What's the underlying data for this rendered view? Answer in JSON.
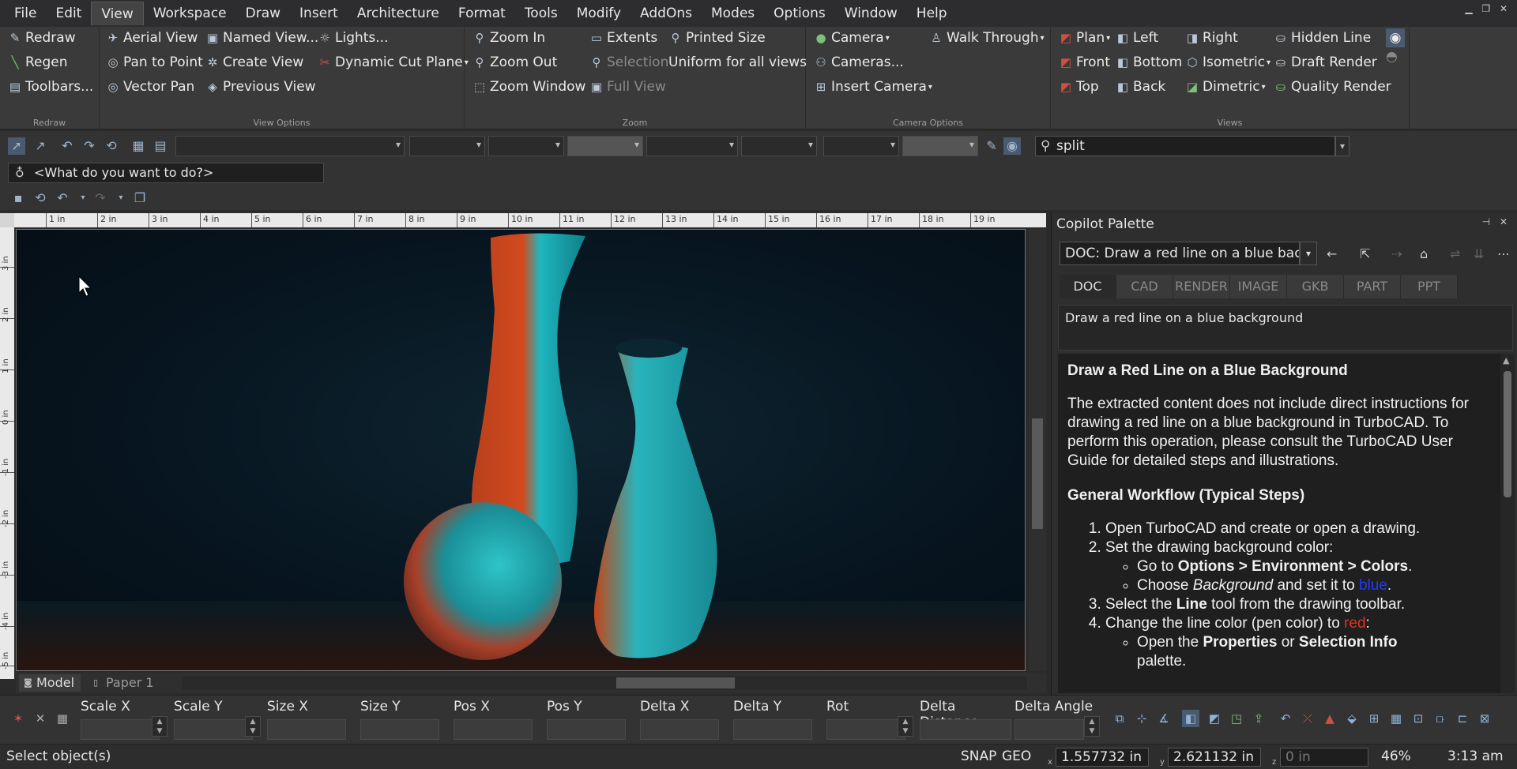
{
  "menu": [
    "File",
    "Edit",
    "View",
    "Workspace",
    "Draw",
    "Insert",
    "Architecture",
    "Format",
    "Tools",
    "Modify",
    "AddOns",
    "Modes",
    "Options",
    "Window",
    "Help"
  ],
  "active_menu": "View",
  "ribbon": {
    "redraw": {
      "title": "Redraw",
      "items": [
        "Redraw",
        "Regen",
        "Toolbars..."
      ]
    },
    "view_options": {
      "title": "View Options",
      "col1": [
        "Aerial View",
        "Pan to Point",
        "Vector Pan"
      ],
      "col2": [
        "Named View...",
        "Create View",
        "Previous View"
      ],
      "col3": [
        "Lights...",
        "Dynamic Cut Plane"
      ]
    },
    "zoom": {
      "title": "Zoom",
      "col1": [
        "Zoom In",
        "Zoom Out",
        "Zoom Window"
      ],
      "col2": [
        "Extents",
        "Selection",
        "Full View"
      ],
      "col3": [
        "Printed Size",
        "Uniform for all views"
      ]
    },
    "camera": {
      "title": "Camera Options",
      "col1": [
        "Camera",
        "Cameras...",
        "Insert Camera"
      ],
      "col2": [
        "Walk Through"
      ]
    },
    "views": {
      "title": "Views",
      "col1": [
        "Plan",
        "Front",
        "Top"
      ],
      "col2": [
        "Left",
        "Bottom",
        "Back"
      ],
      "col3": [
        "Right",
        "Isometric",
        "Dimetric"
      ],
      "col4": [
        "Hidden Line",
        "Draft Render",
        "Quality Render"
      ]
    }
  },
  "toolbar": {
    "search_value": "split",
    "what_placeholder": "<What do you want to do?>"
  },
  "ruler": {
    "h_labels": [
      "1 in",
      "2 in",
      "3 in",
      "4 in",
      "5 in",
      "6 in",
      "7 in",
      "8 in",
      "9 in",
      "10 in",
      "11 in",
      "12 in",
      "13 in",
      "14 in",
      "15 in",
      "16 in",
      "17 in",
      "18 in",
      "19 in"
    ],
    "v_labels": [
      "3 in",
      "2 in",
      "1 in",
      "0 in",
      "-1 in",
      "-2 in",
      "-3 in",
      "-4 in",
      "-5 in"
    ]
  },
  "sheet_tabs": [
    "Model",
    "Paper 1"
  ],
  "copilot": {
    "title": "Copilot Palette",
    "select_value": "DOC: Draw a red line on a blue background",
    "tabs": [
      "DOC",
      "CAD",
      "RENDER",
      "IMAGE",
      "GKB",
      "PART",
      "PPT"
    ],
    "active_tab": "DOC",
    "query": "Draw a red line on a blue background",
    "answer": {
      "heading": "Draw a Red Line on a Blue Background",
      "intro": "The extracted content does not include direct instructions for drawing a red line on a blue background in TurboCAD. To perform this operation, please consult the TurboCAD User Guide for detailed steps and illustrations.",
      "subheading": "General Workflow (Typical Steps)",
      "step1": "Open TurboCAD and create or open a drawing.",
      "step2": "Set the drawing background color:",
      "step2a_pre": "Go to ",
      "step2a_bold": "Options > Environment > Colors",
      "step2a_post": ".",
      "step2b_pre": "Choose ",
      "step2b_em": "Background",
      "step2b_mid": " and set it to ",
      "step2b_color": "blue",
      "step2b_post": ".",
      "step3_pre": "Select the ",
      "step3_bold": "Line",
      "step3_post": " tool from the drawing toolbar.",
      "step4_pre": "Change the line color (pen color) to ",
      "step4_color": "red",
      "step4_post": ":",
      "step4a_pre": "Open the ",
      "step4a_bold1": "Properties",
      "step4a_mid": " or ",
      "step4a_bold2": "Selection Info",
      "step4a_post": "palette."
    }
  },
  "props": [
    "Scale X",
    "Scale Y",
    "Size X",
    "Size Y",
    "Pos X",
    "Pos Y",
    "Delta X",
    "Delta Y",
    "Rot",
    "Delta Distance",
    "Delta Angle"
  ],
  "status": {
    "message": "Select object(s)",
    "snap": "SNAP",
    "geo": "GEO",
    "x": "1.557732 in",
    "y": "2.621132 in",
    "z": "0 in",
    "zoom": "46%",
    "time": "3:13 am"
  }
}
